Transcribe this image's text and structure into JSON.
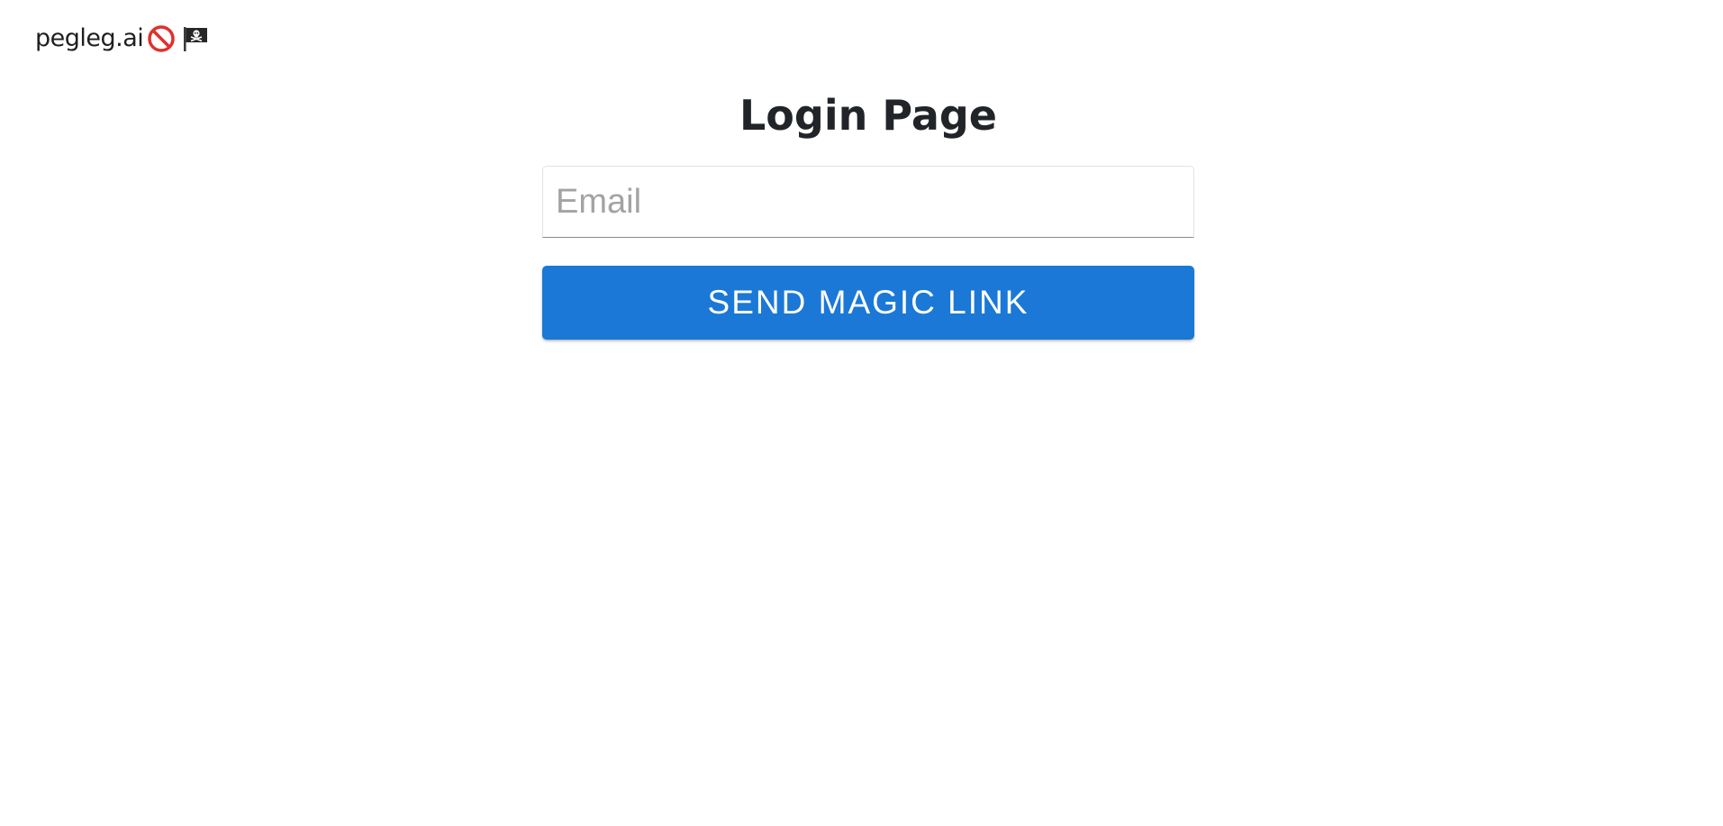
{
  "header": {
    "brand_name": "pegleg.ai",
    "icons": [
      "prohibited-icon",
      "pirate-flag-icon"
    ]
  },
  "main": {
    "title": "Login Page",
    "email": {
      "value": "",
      "placeholder": "Email"
    },
    "submit_label": "SEND MAGIC LINK"
  },
  "colors": {
    "primary_button": "#1b78d6",
    "title_text": "#212529",
    "placeholder_text": "#a3a3a3",
    "background": "#ffffff"
  }
}
